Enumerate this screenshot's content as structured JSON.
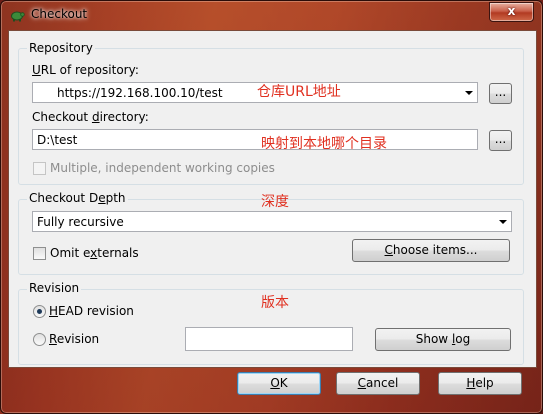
{
  "window": {
    "title": "Checkout",
    "close_label": "x"
  },
  "repository": {
    "group_label": "Repository",
    "url_label": "URL of repository:",
    "url_value": "https://192.168.100.10/test",
    "browse_url_label": "...",
    "dir_label": "Checkout directory:",
    "dir_value": "D:\\test",
    "browse_dir_label": "...",
    "multiple_label": "Multiple, independent working copies"
  },
  "depth": {
    "group_label": "Checkout Depth",
    "selected": "Fully recursive",
    "omit_label": "Omit externals",
    "choose_label": "Choose items..."
  },
  "revision": {
    "group_label": "Revision",
    "head_label": "HEAD revision",
    "revision_label": "Revision",
    "revision_value": "",
    "show_log_label": "Show log"
  },
  "buttons": {
    "ok": "OK",
    "cancel": "Cancel",
    "help": "Help"
  },
  "annotations": {
    "url_note": "仓库URL地址",
    "dir_note": "映射到本地哪个目录",
    "depth_note": "深度",
    "revision_note": "版本"
  },
  "colors": {
    "annotation": "#e03020",
    "accent_border": "#3c7fb1"
  },
  "icons": {
    "app": "tortoise-icon",
    "close": "close-icon",
    "combo": "chevron-down-icon"
  }
}
